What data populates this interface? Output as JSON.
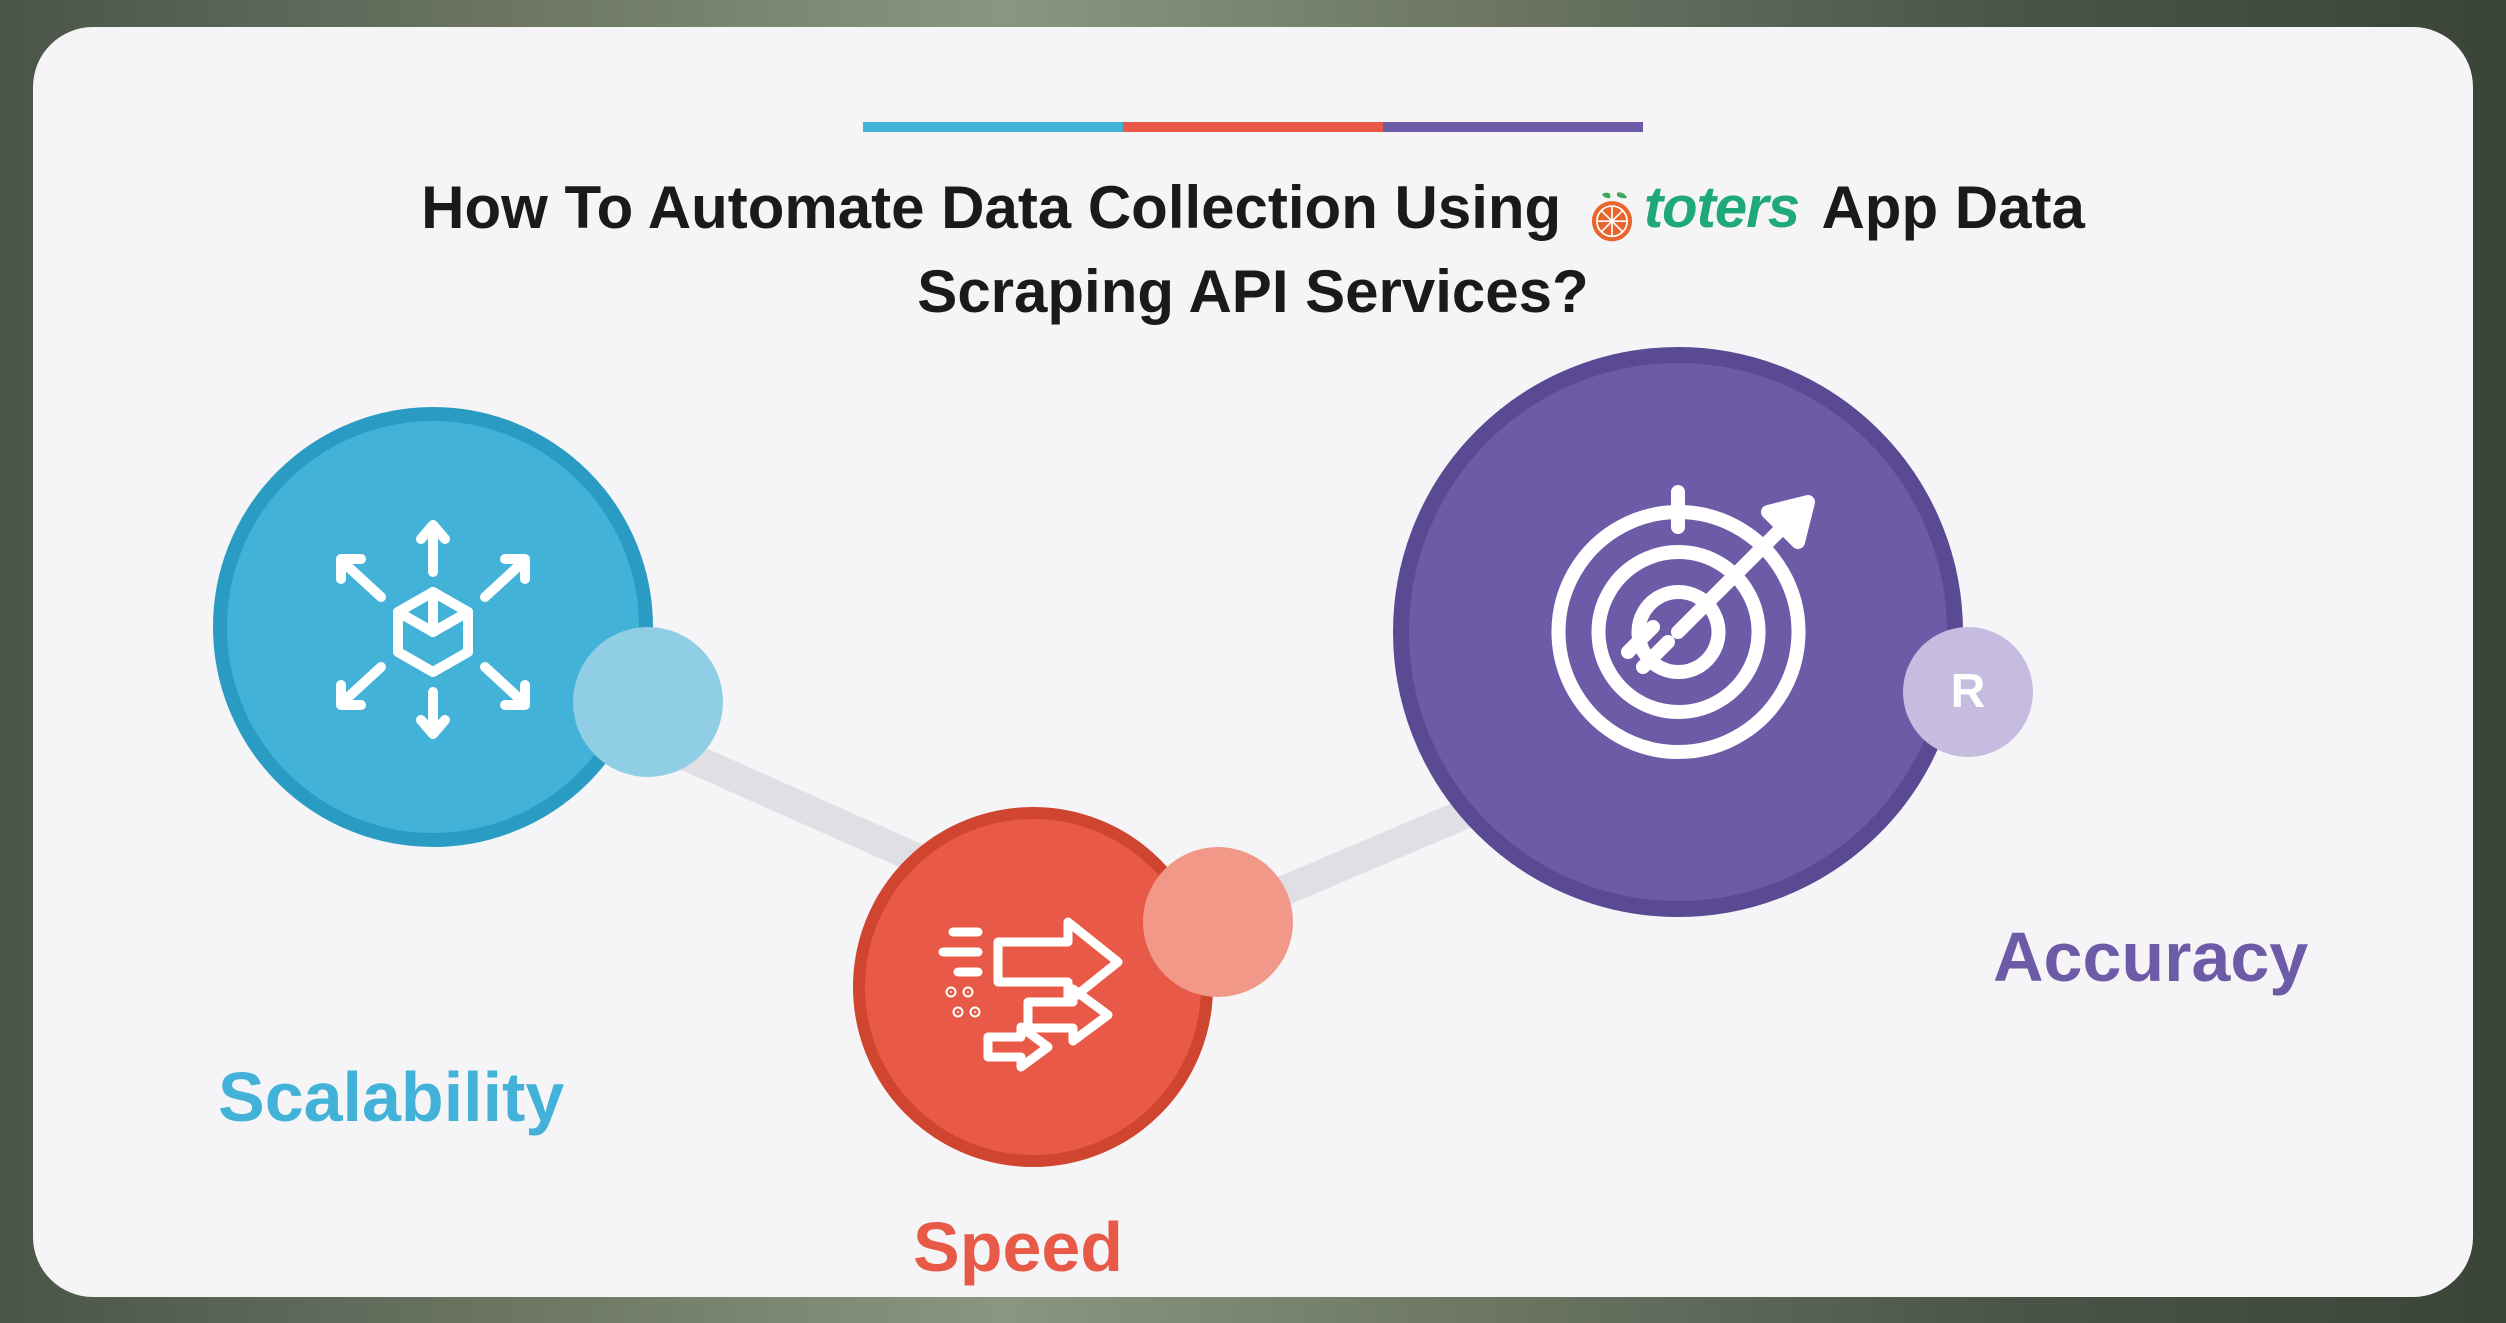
{
  "title": {
    "line1_pre": "How To Automate Data Collection Using",
    "line1_post": "App Data",
    "line2": "Scraping API Services?"
  },
  "brand": {
    "name": "toters"
  },
  "features": {
    "scalability": {
      "label": "Scalability",
      "color": "#42b2d8"
    },
    "speed": {
      "label": "Speed",
      "color": "#e85a47"
    },
    "accuracy": {
      "label": "Accuracy",
      "color": "#6e5ba8",
      "badge_letter": "R"
    }
  },
  "colors": {
    "blue": "#42b2d8",
    "red": "#e85a47",
    "purple": "#6e5ba8",
    "brand_green": "#1fa878",
    "brand_orange": "#e8662d"
  }
}
